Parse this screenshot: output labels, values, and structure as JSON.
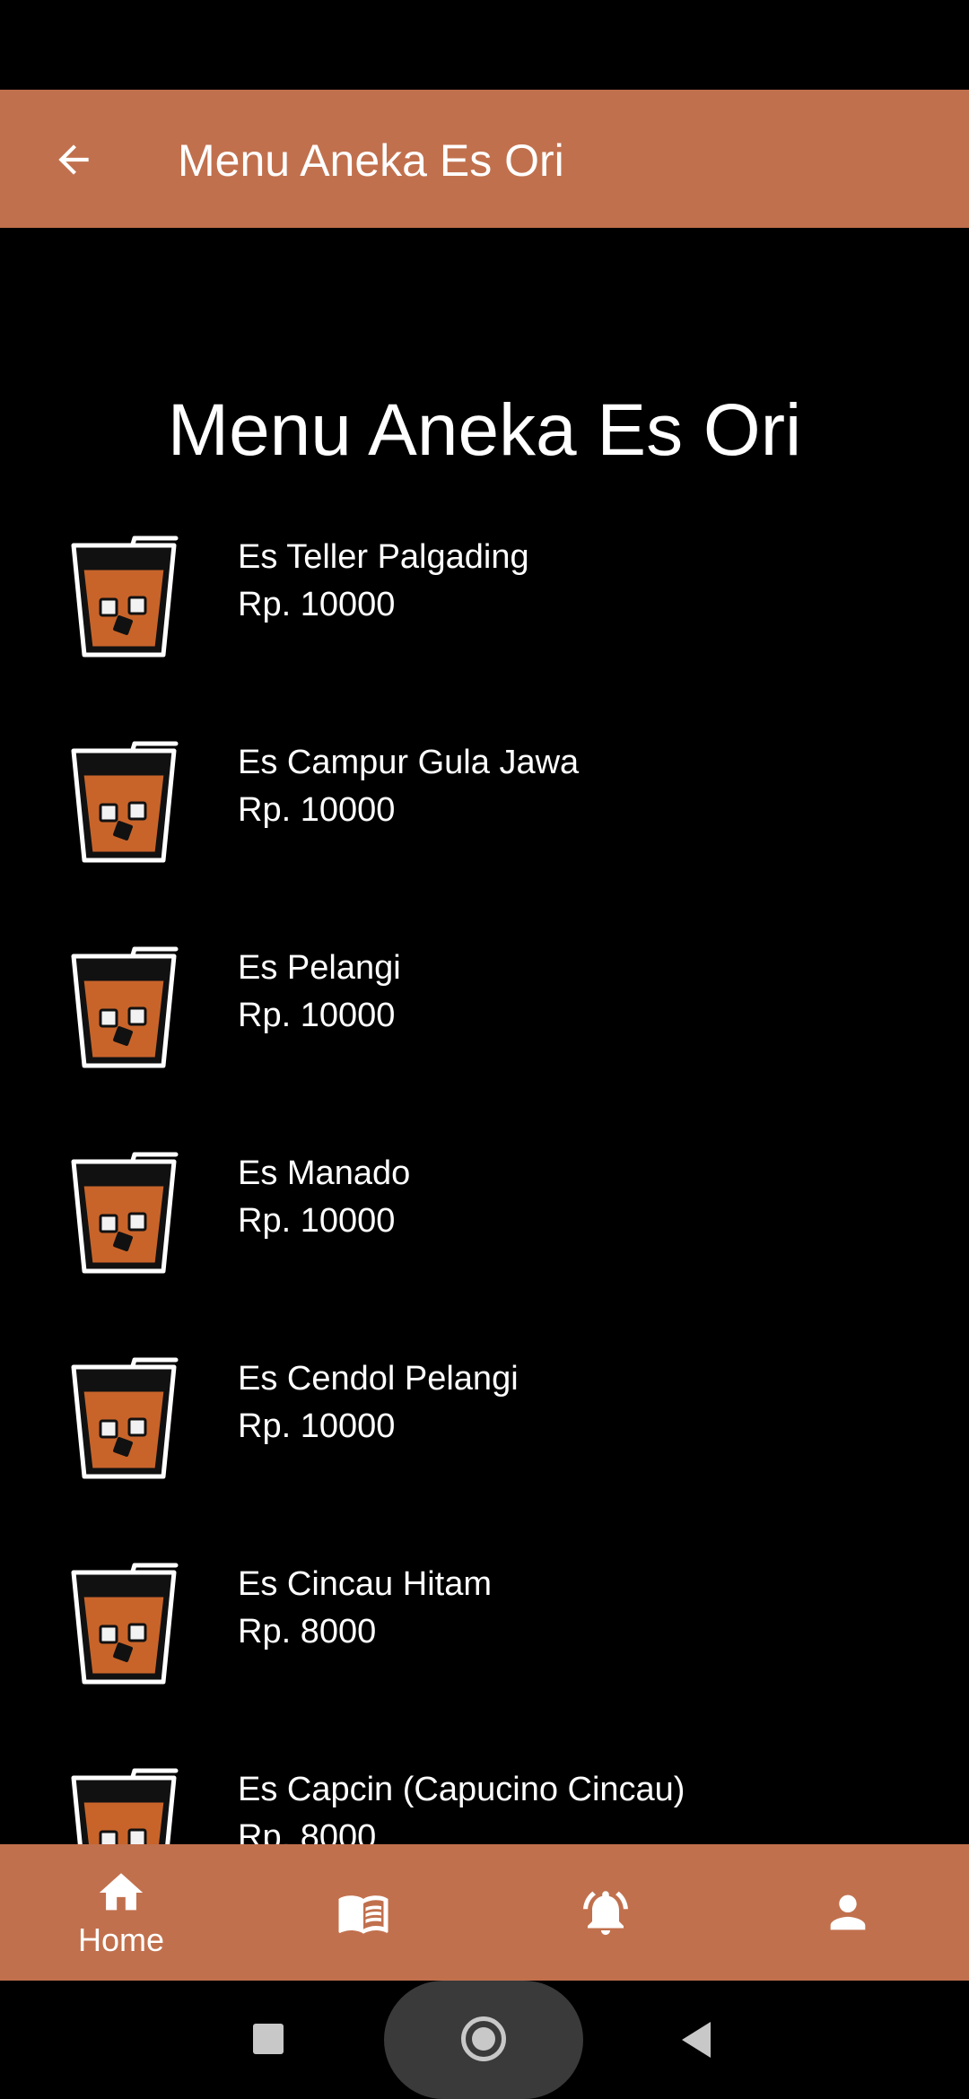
{
  "app_bar": {
    "title": "Menu Aneka Es Ori",
    "back_icon": "arrow-left-icon"
  },
  "page": {
    "heading": "Menu Aneka Es Ori"
  },
  "menu_items": [
    {
      "name": "Es Teller Palgading",
      "price": "Rp. 10000"
    },
    {
      "name": "Es Campur Gula Jawa",
      "price": "Rp. 10000"
    },
    {
      "name": "Es Pelangi",
      "price": "Rp. 10000"
    },
    {
      "name": "Es Manado",
      "price": "Rp. 10000"
    },
    {
      "name": "Es Cendol Pelangi",
      "price": "Rp. 10000"
    },
    {
      "name": "Es Cincau Hitam",
      "price": "Rp. 8000"
    },
    {
      "name": "Es Capcin (Capucino Cincau)",
      "price": "Rp. 8000"
    }
  ],
  "bottom_nav": {
    "items": [
      {
        "icon": "home-icon",
        "label": "Home"
      },
      {
        "icon": "book-icon",
        "label": ""
      },
      {
        "icon": "bell-icon",
        "label": ""
      },
      {
        "icon": "person-icon",
        "label": ""
      }
    ]
  },
  "colors": {
    "accent": "#C1704D",
    "background": "#000000",
    "drink_fill": "#C8642A"
  }
}
